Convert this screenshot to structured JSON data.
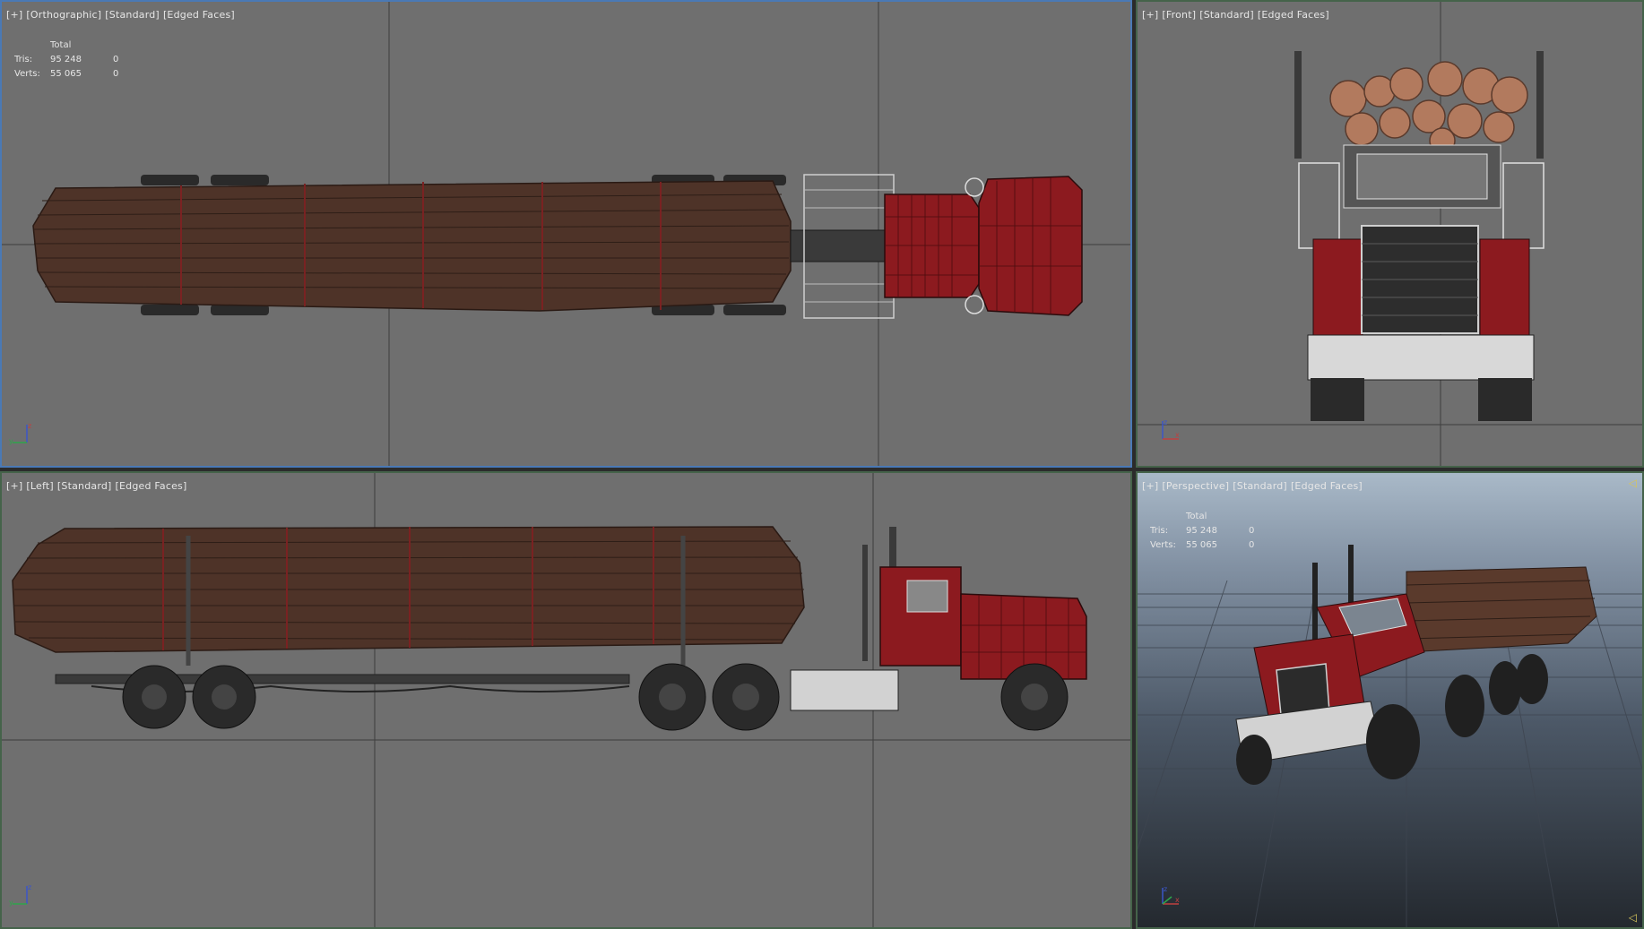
{
  "viewports": {
    "ortho": {
      "labels": [
        "[+]",
        "[Orthographic]",
        "[Standard]",
        "[Edged Faces]"
      ]
    },
    "front": {
      "labels": [
        "[+]",
        "[Front]",
        "[Standard]",
        "[Edged Faces]"
      ]
    },
    "left": {
      "labels": [
        "[+]",
        "[Left]",
        "[Standard]",
        "[Edged Faces]"
      ]
    },
    "persp": {
      "labels": [
        "[+]",
        "[Perspective]",
        "[Standard]",
        "[Edged Faces]"
      ]
    }
  },
  "stats": {
    "header": "Total",
    "tris_label": "Tris:",
    "tris_total": "95 248",
    "tris_sel": "0",
    "verts_label": "Verts:",
    "verts_total": "55 065",
    "verts_sel": "0"
  },
  "axes": {
    "x": "x",
    "y": "y",
    "z": "z"
  },
  "colors": {
    "viewport_bg": "#6f6f6f",
    "active_border": "#4a79b5",
    "inactive_border": "#45634a",
    "truck_red": "#8c1a1f",
    "log_brown": "#5a3a2c"
  },
  "icons": {
    "side_marker": "triangle-marker-icon"
  }
}
